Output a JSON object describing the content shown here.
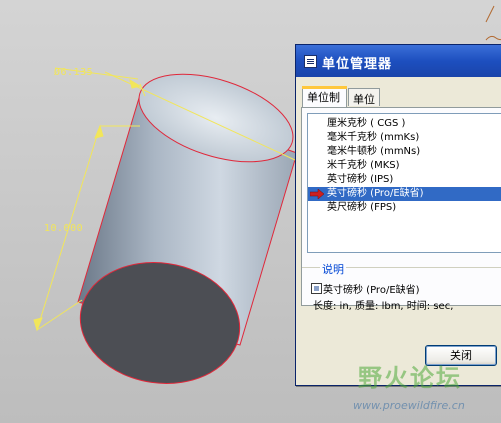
{
  "dimensions": {
    "diameter": "Ø6.135",
    "height": "10.000"
  },
  "dialog": {
    "title": "单位管理器",
    "tabs": [
      {
        "label": "单位制"
      },
      {
        "label": "单位"
      }
    ],
    "unit_systems": [
      {
        "label": "厘米克秒 ( CGS )"
      },
      {
        "label": "毫米千克秒 (mmKs)"
      },
      {
        "label": "毫米牛顿秒 (mmNs)"
      },
      {
        "label": "米千克秒 (MKS)"
      },
      {
        "label": "英寸磅秒 (IPS)"
      },
      {
        "label": "英寸磅秒 (Pro/E缺省)",
        "selected": true
      },
      {
        "label": "英尺磅秒 (FPS)"
      }
    ],
    "description": {
      "group_title": "说明",
      "name": "英寸磅秒 (Pro/E缺省)",
      "detail": "长度: in, 质量: lbm, 时间: sec,"
    },
    "close_label": "关闭"
  },
  "watermark": {
    "name": "野火论坛",
    "url": "www.proewildfire.cn"
  },
  "colors": {
    "titlebar": "#1d4fbf",
    "selection": "#316ac5",
    "edge_red": "#e0283a",
    "dimension_yellow": "#f2e65a",
    "arrow_red": "#cc2020"
  }
}
